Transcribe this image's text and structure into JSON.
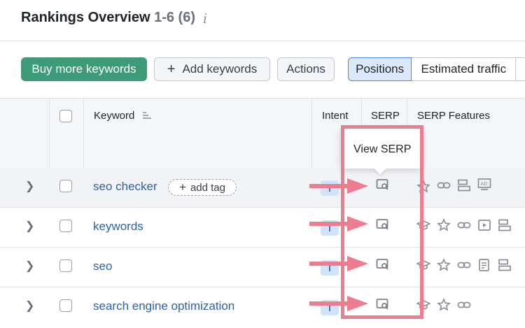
{
  "header": {
    "title": "Rankings Overview",
    "range": "1-6 (6)"
  },
  "toolbar": {
    "buy_label": "Buy more keywords",
    "add_label": "Add keywords",
    "actions_label": "Actions",
    "tabs": [
      {
        "label": "Positions",
        "selected": true
      },
      {
        "label": "Estimated traffic",
        "selected": false
      }
    ]
  },
  "table": {
    "columns": {
      "keyword": "Keyword",
      "intent": "Intent",
      "serp": "SERP",
      "serp_features": "SERP Features"
    },
    "rows": [
      {
        "keyword": "seo checker",
        "tag_label": "add tag",
        "features": [
          "star-icon",
          "link-icon",
          "list-icon",
          "ads-icon"
        ]
      },
      {
        "keyword": "keywords",
        "features": [
          "graduation-cap-icon",
          "star-icon",
          "link-icon",
          "video-icon",
          "list-icon"
        ]
      },
      {
        "keyword": "seo",
        "features": [
          "graduation-cap-icon",
          "star-icon",
          "link-icon",
          "news-icon",
          "list-icon"
        ]
      },
      {
        "keyword": "search engine optimization",
        "features": [
          "graduation-cap-icon",
          "star-icon",
          "link-icon"
        ]
      }
    ]
  },
  "tooltip": {
    "text": "View SERP"
  },
  "colors": {
    "accent_green": "#3d9b7a",
    "link_blue": "#2e62a8",
    "annotation_pink": "#ec7d8f",
    "selected_tab_bg": "#dbe9fb"
  }
}
